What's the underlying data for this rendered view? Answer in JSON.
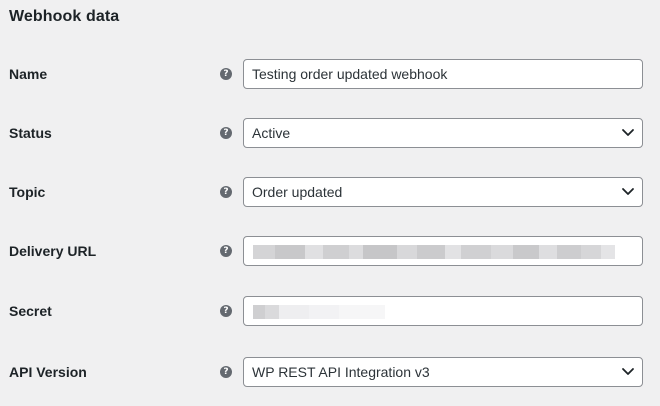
{
  "section": {
    "title": "Webhook data"
  },
  "fields": {
    "name": {
      "label": "Name",
      "value": "Testing order updated webhook"
    },
    "status": {
      "label": "Status",
      "value": "Active"
    },
    "topic": {
      "label": "Topic",
      "value": "Order updated"
    },
    "delivery_url": {
      "label": "Delivery URL",
      "value": ""
    },
    "secret": {
      "label": "Secret",
      "value": ""
    },
    "api_version": {
      "label": "API Version",
      "value": "WP REST API Integration v3"
    }
  },
  "icons": {
    "help": "help-icon",
    "select_arrow": "chevron-down-icon"
  },
  "colors": {
    "background": "#f0f0f1",
    "text": "#1d2327",
    "field_border": "#8c8f94",
    "help_icon": "#646970"
  }
}
